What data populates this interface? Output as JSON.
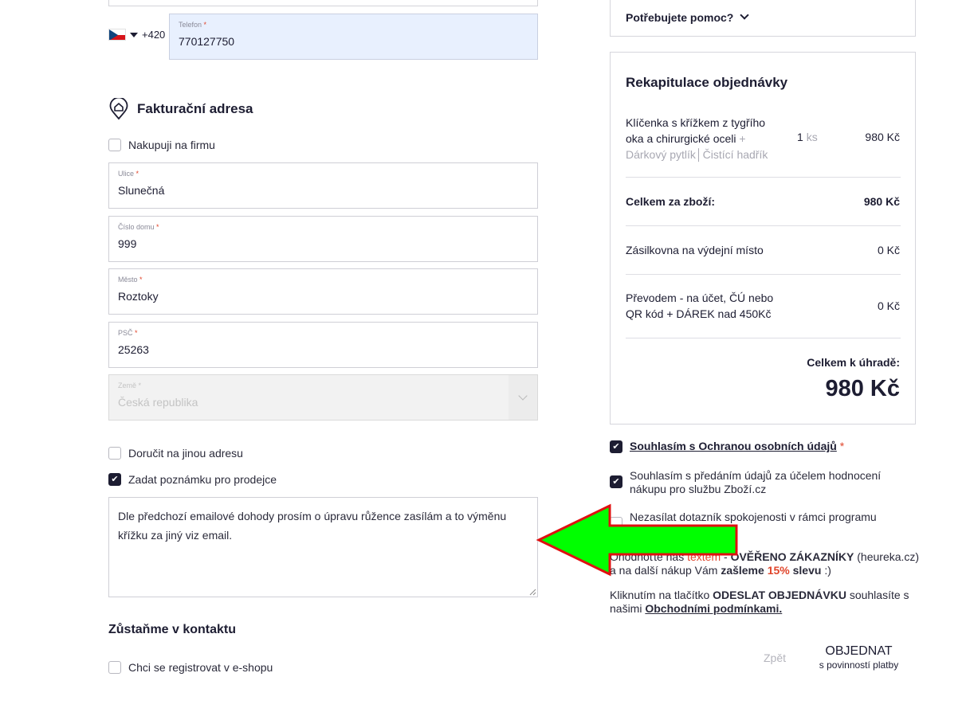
{
  "phone": {
    "prefix": "+420",
    "label": "Telefon",
    "required_mark": "*",
    "value": "770127750"
  },
  "billing": {
    "title": "Fakturační adresa",
    "company_checkbox": "Nakupuji na firmu",
    "street_label": "Ulice",
    "street_value": "Slunečná",
    "house_label": "Číslo domu",
    "house_value": "999",
    "city_label": "Město",
    "city_value": "Roztoky",
    "zip_label": "PSČ",
    "zip_value": "25263",
    "country_label": "Země",
    "country_value": "Česká republika",
    "required_mark": "*"
  },
  "options": {
    "other_address": "Doručit na jinou adresu",
    "seller_note": "Zadat poznámku pro prodejce",
    "seller_note_checked": true,
    "note_text": "Dle předchozí emailové dohody prosím o úpravu růžence zasílám a to výměnu křížku za jiný viz email."
  },
  "contact": {
    "title": "Zůstaňme v kontaktu",
    "register": "Chci se registrovat v e-shopu"
  },
  "help": {
    "label": "Potřebujete pomoc?"
  },
  "summary": {
    "title": "Rekapitulace objednávky",
    "item_name": "Klíčenka s křížkem z tygřího oka a chirurgické oceli",
    "item_extras": "+ Dárkový pytlík│Čistící hadřík",
    "item_qty": "1",
    "item_unit": "ks",
    "item_price": "980 Kč",
    "goods_total_label": "Celkem za zboží:",
    "goods_total_value": "980 Kč",
    "shipping_label": "Zásilkovna na výdejní místo",
    "shipping_value": "0 Kč",
    "payment_label": "Převodem - na účet, ČÚ nebo QR kód + DÁREK nad 450Kč",
    "payment_value": "0 Kč",
    "total_label": "Celkem k úhradě:",
    "total_value": "980 Kč"
  },
  "consents": {
    "privacy": "Souhlasím s Ochranou osobních údajů",
    "privacy_required": "*",
    "zbozi": "Souhlasím s předáním údajů za účelem hodnocení nákupu pro službu Zboží.cz",
    "no_survey": "Nezasílat dotazník spokojenosti v rámci programu Ověřeno zákazníky"
  },
  "review": {
    "part1": "Ohodnoťte nás",
    "part2": "textem",
    "part3": "-",
    "part4": "OVĚŘENO ZÁKAZNÍKY",
    "part5": "(heureka.cz) a na další nákup Vám",
    "part6": "zašleme",
    "part7": "15%",
    "part8": "slevu",
    "part9": ":)"
  },
  "terms": {
    "part1": "Kliknutím na tlačítko",
    "part2": "ODESLAT OBJEDNÁVKU",
    "part3": "souhlasíte s našimi",
    "part4": "Obchodními podmínkami."
  },
  "actions": {
    "back": "Zpět",
    "order_main": "OBJEDNAT",
    "order_sub": "s povinností platby"
  },
  "colors": {
    "arrow_fill": "#00ff00",
    "arrow_stroke": "#e01010",
    "text": "#1d1d32",
    "accent_red": "#e0452b"
  }
}
